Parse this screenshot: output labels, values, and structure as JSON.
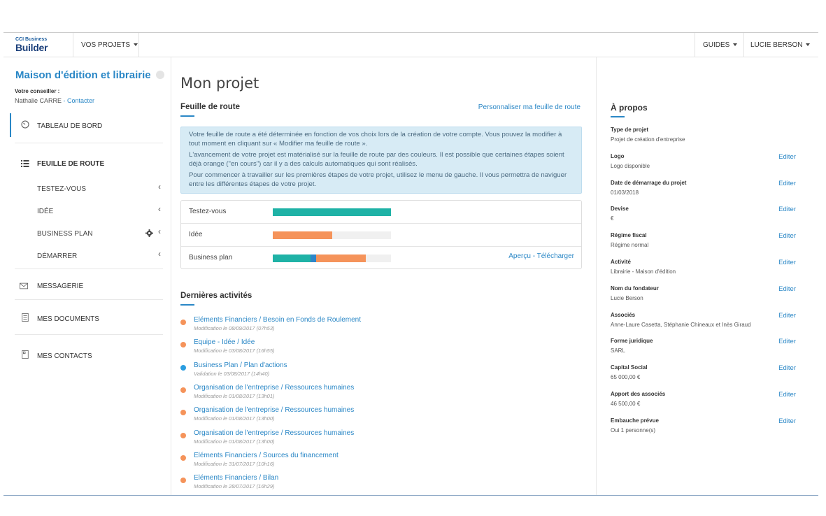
{
  "topnav": {
    "logo_small": "CCI Business",
    "logo_big": "Builder",
    "projects_menu": "VOS PROJETS",
    "guides_menu": "GUIDES",
    "user_menu": "LUCIE BERSON"
  },
  "sidebar": {
    "project_title": "Maison d'édition et librairie",
    "advisor_label": "Votre conseiller :",
    "advisor_name": "Nathalie CARRE",
    "advisor_sep": " - ",
    "contact_link": "Contacter",
    "dashboard": "TABLEAU DE BORD",
    "roadmap": "FEUILLE DE ROUTE",
    "sub_items": [
      "TESTEZ-VOUS",
      "IDÉE",
      "BUSINESS PLAN",
      "DÉMARRER"
    ],
    "messaging": "MESSAGERIE",
    "documents": "MES DOCUMENTS",
    "contacts": "MES CONTACTS"
  },
  "main": {
    "page_title": "Mon projet",
    "roadmap_title": "Feuille de route",
    "personalize_link": "Personnaliser ma feuille de route",
    "info_p1": "Votre feuille de route a été déterminée en fonction de vos choix lors de la création de votre compte. Vous pouvez la modifier à tout moment en cliquant sur « Modifier ma feuille de route ».",
    "info_p2": "L'avancement de votre projet est matérialisé sur la feuille de route par des couleurs. Il est possible que certaines étapes soient déjà orange (\"en cours\") car il y a des calculs automatiques qui sont réalisés.",
    "info_p3": "Pour commencer à travailler sur les premières étapes de votre projet, utilisez le menu de gauche. Il vous permettra de naviguer entre les différentes étapes de votre projet.",
    "progress": [
      {
        "label": "Testez-vous",
        "segments": [
          {
            "color": "#1fb2a6",
            "fraction": 1.0
          }
        ]
      },
      {
        "label": "Idée",
        "segments": [
          {
            "color": "#f5935a",
            "fraction": 0.5
          }
        ]
      },
      {
        "label": "Business plan",
        "segments": [
          {
            "color": "#1fb2a6",
            "fraction": 0.32
          },
          {
            "color": "#2f86c8",
            "fraction": 0.05
          },
          {
            "color": "#f5935a",
            "fraction": 0.42
          }
        ]
      }
    ],
    "bp_links": "Aperçu - Télécharger",
    "activities_title": "Dernières activités",
    "activities": [
      {
        "title": "Eléments Financiers / Besoin en Fonds de Roulement",
        "sub": "Modification le 08/09/2017 (07h53)",
        "color": "#f5935a"
      },
      {
        "title": "Equipe - Idée / Idée",
        "sub": "Modification le 03/08/2017 (16h55)",
        "color": "#f5935a"
      },
      {
        "title": "Business Plan / Plan d'actions",
        "sub": "Validation le 03/08/2017 (14h40)",
        "color": "#2a9de0"
      },
      {
        "title": "Organisation de l'entreprise / Ressources humaines",
        "sub": "Modification le 01/08/2017 (13h01)",
        "color": "#f5935a"
      },
      {
        "title": "Organisation de l'entreprise / Ressources humaines",
        "sub": "Modification le 01/08/2017 (13h00)",
        "color": "#f5935a"
      },
      {
        "title": "Organisation de l'entreprise / Ressources humaines",
        "sub": "Modification le 01/08/2017 (13h00)",
        "color": "#f5935a"
      },
      {
        "title": "Eléments Financiers / Sources du financement",
        "sub": "Modification le 31/07/2017 (10h16)",
        "color": "#f5935a"
      },
      {
        "title": "Eléments Financiers / Bilan",
        "sub": "Modification le 28/07/2017 (16h29)",
        "color": "#f5935a"
      }
    ]
  },
  "about": {
    "title": "À propos",
    "edit_label": "Editer",
    "fields": [
      {
        "label": "Type de projet",
        "value": "Projet de création d'entreprise",
        "editable": false
      },
      {
        "label": "Logo",
        "value": "Logo disponible",
        "editable": true
      },
      {
        "label": "Date de démarrage du projet",
        "value": "01/03/2018",
        "editable": true
      },
      {
        "label": "Devise",
        "value": "€",
        "editable": true
      },
      {
        "label": "Régime fiscal",
        "value": "Régime normal",
        "editable": true
      },
      {
        "label": "Activité",
        "value": "Librairie - Maison d'édition",
        "editable": true
      },
      {
        "label": "Nom du fondateur",
        "value": "Lucie Berson",
        "editable": true
      },
      {
        "label": "Associés",
        "value": "Anne-Laure Casetta, Stéphanie Chineaux et Inès Giraud",
        "editable": true
      },
      {
        "label": "Forme juridique",
        "value": "SARL",
        "editable": true
      },
      {
        "label": "Capital Social",
        "value": "65 000,00 €",
        "editable": true
      },
      {
        "label": "Apport des associés",
        "value": "46 500,00 €",
        "editable": true
      },
      {
        "label": "Embauche prévue",
        "value": "Oui 1 personne(s)",
        "editable": true
      }
    ]
  },
  "colors": {
    "accent": "#2a87c6",
    "teal": "#1fb2a6",
    "orange": "#f5935a",
    "info_bg": "#d7ebf5"
  }
}
